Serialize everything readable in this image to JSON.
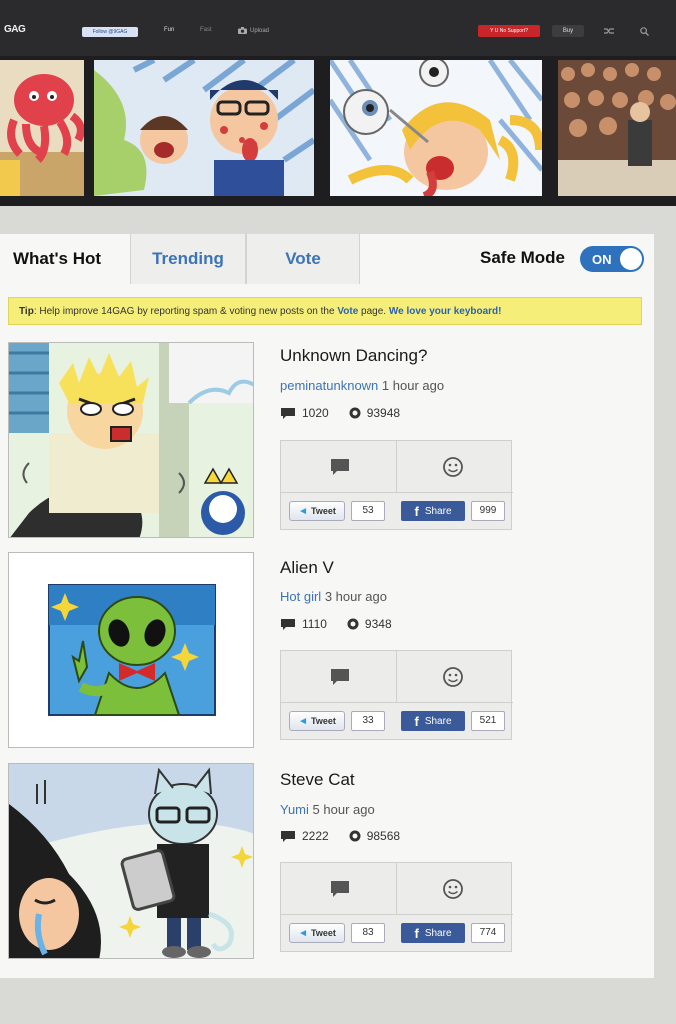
{
  "header": {
    "logo": "GAG",
    "follow_label": "Follow @9GAG",
    "nav": [
      "Fun",
      "Fast"
    ],
    "upload_label": "Upload",
    "support_label": "Y U No Support?",
    "buy_label": "Buy"
  },
  "tabs": {
    "hot": "What's Hot",
    "trending": "Trending",
    "vote": "Vote"
  },
  "safe_mode": {
    "label": "Safe Mode",
    "state": "ON"
  },
  "tip": {
    "prefix": "Tip",
    "text": ": Help improve 14GAG by reporting spam & voting new posts on the ",
    "vote_link": "Vote",
    "text2": " page. ",
    "keyboard_link": "We love your keyboard!"
  },
  "posts": [
    {
      "title": "Unknown Dancing?",
      "author": "peminatunknown",
      "time": "1 hour ago",
      "comments": "1020",
      "points": "93948",
      "tweet_label": "Tweet",
      "tweet_count": "53",
      "share_label": "Share",
      "share_count": "999"
    },
    {
      "title": "Alien V",
      "author": "Hot girl",
      "time": "3 hour ago",
      "comments": "1110",
      "points": "9348",
      "tweet_label": "Tweet",
      "tweet_count": "33",
      "share_label": "Share",
      "share_count": "521"
    },
    {
      "title": "Steve Cat",
      "author": "Yumi",
      "time": "5 hour ago",
      "comments": "2222",
      "points": "98568",
      "tweet_label": "Tweet",
      "tweet_count": "83",
      "share_label": "Share",
      "share_count": "774"
    }
  ],
  "colors": {
    "accent_blue": "#3b74b8",
    "toggle_blue": "#2e72bd",
    "tip_yellow": "#f5ef7a",
    "facebook": "#3b5a9a",
    "support_red": "#c9262b"
  }
}
